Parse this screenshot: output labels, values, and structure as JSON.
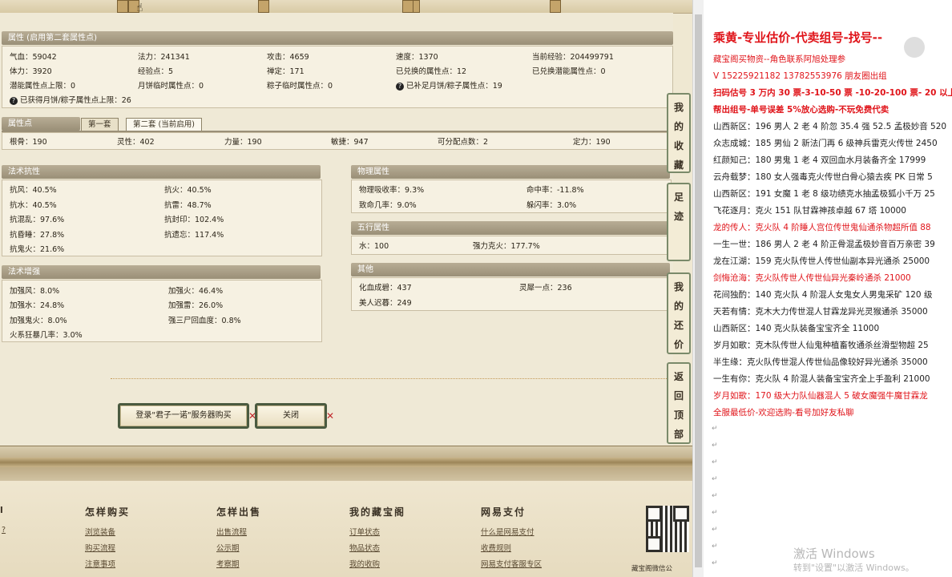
{
  "attrs": {
    "title": "属性 (启用第二套属性点)",
    "r1": [
      "气血：59042",
      "法力：241341",
      "攻击：4659",
      "速度：1370",
      "当前经验：204499791"
    ],
    "r2": [
      "体力：3920",
      "经验点：5",
      "禅定：171",
      "已兑换的属性点：12",
      "已兑换潜能属性点：0"
    ],
    "r3": [
      "潜能属性点上限：0",
      "月饼临时属性点：0",
      "粽子临时属性点：0",
      "已补足月饼/粽子属性点：19"
    ],
    "r4": "已获得月饼/粽子属性点上限：26"
  },
  "points": {
    "title": "属性点",
    "tab1": "第一套",
    "tab2": "第二套 (当前启用)",
    "row": [
      "根骨：190",
      "灵性：402",
      "力量：190",
      "敏捷：947",
      "可分配点数：2",
      "定力：190"
    ]
  },
  "resist": {
    "title": "法术抗性",
    "left": [
      "抗风：40.5%",
      "抗水：40.5%",
      "抗混乱：97.6%",
      "抗昏睡：27.8%",
      "抗鬼火：21.6%"
    ],
    "right": [
      "抗火：40.5%",
      "抗雷：48.7%",
      "抗封印：102.4%",
      "抗遗忘：117.4%"
    ]
  },
  "boost": {
    "title": "法术增强",
    "left": [
      "加强风：8.0%",
      "加强水：24.8%",
      "加强鬼火：8.0%",
      "火系狂暴几率：3.0%"
    ],
    "right": [
      "加强火：46.4%",
      "加强雷：26.0%",
      "强三尸回血度：0.8%"
    ]
  },
  "physical": {
    "title": "物理属性",
    "left": [
      "物理吸收率：9.3%",
      "致命几率：9.0%"
    ],
    "right": [
      "命中率：-11.8%",
      "躲闪率：3.0%"
    ]
  },
  "wuxing": {
    "title": "五行属性",
    "left": "水：100",
    "right": "强力克火：177.7%"
  },
  "other": {
    "title": "其他",
    "left": [
      "化血成碧：437",
      "美人迟暮：249"
    ],
    "right": "灵犀一点：236"
  },
  "buttons": {
    "login": "登录\"君子一诺\"服务器购买",
    "close": "关闭"
  },
  "sidetabs": [
    "我的收藏",
    "足迹",
    "我的还价",
    "返回顶部"
  ],
  "footer": {
    "heads": [
      "怎样购买",
      "怎样出售",
      "我的藏宝阁",
      "网易支付"
    ],
    "col1": [
      "浏览装备",
      "购买流程",
      "注意事项"
    ],
    "col2": [
      "出售流程",
      "公示期",
      "考察期"
    ],
    "col3": [
      "订单状态",
      "物品状态",
      "我的收购"
    ],
    "col4": [
      "什么是网易支付",
      "收费规则",
      "网易支付客服专区"
    ],
    "qr_label": "藏宝阁微信公",
    "left_q": "?"
  },
  "notes": {
    "heading": "乘黄-专业估价-代卖组号-找号--",
    "lines": [
      {
        "t": "藏宝阁买物资--角色联系阿旭处理参",
        "c": "red"
      },
      {
        "t": "V 15225921182    13782553976 朋友圈出组",
        "c": "red"
      },
      {
        "t": "扫码估号 3 万内 30 票-3-10-50 票 -10-20-100 票- 20 以上",
        "c": "redb"
      },
      {
        "t": "帮出组号-单号误差 5%放心选购-不玩免费代卖",
        "c": "redb"
      },
      {
        "t": "山西新区：196 男人 2 老 4 阶忽 35.4 强 52.5 孟极妙音 520",
        "c": "n"
      },
      {
        "t": "众志成城：185 男仙 2 新法门再 6 级神兵雷克火传世 2450",
        "c": "n"
      },
      {
        "t": "红颜知己：180 男鬼 1 老 4 双回血水月装备齐全 17999",
        "c": "n"
      },
      {
        "t": "云舟载梦：180 女人强毒克火传世白骨心猿去疾 PK 日常 5",
        "c": "n"
      },
      {
        "t": "山西新区：191 女魔 1 老 8 级功绩克水抽孟极狐小千万 25",
        "c": "n"
      },
      {
        "t": "飞花逐月：克火 151 队甘霖神孩卓越 67 塔 10000",
        "c": "n"
      },
      {
        "t": "龙的传人：克火队 4 阶睡人宫位传世鬼仙通杀物超所值 88",
        "c": "red"
      },
      {
        "t": "一生一世：186 男人 2 老 4 阶正骨混孟极妙音百万亲密 39",
        "c": "n"
      },
      {
        "t": "龙在江湖：159 克火队传世人传世仙副本异光通杀 25000",
        "c": "n"
      },
      {
        "t": "剑悔沧海：克火队传世人传世仙异光秦岭通杀 21000",
        "c": "red"
      },
      {
        "t": "花间独酌：140 克火队 4 阶混人女鬼女人男鬼采矿 120 级",
        "c": "n"
      },
      {
        "t": "天若有情：克木大力传世混人甘霖龙异光灵猴通杀 35000",
        "c": "n"
      },
      {
        "t": "山西新区：140 克火队装备宝宝齐全 11000",
        "c": "n"
      },
      {
        "t": "岁月如歌：克木队传世人仙鬼种植畜牧通杀丝滑型物超 25",
        "c": "n"
      },
      {
        "t": "半生缘：克火队传世混人传世仙品像较好异光通杀 35000",
        "c": "n"
      },
      {
        "t": "一生有你：克火队 4 阶混人装备宝宝齐全上手盈利 21000",
        "c": "n"
      },
      {
        "t": "岁月如歌：170 级大力队仙器混人 5 破女魔强牛魔甘霖龙",
        "c": "red"
      },
      {
        "t": "全服最低价-欢迎选购-看号加好友私聊",
        "c": "red"
      }
    ],
    "return_mark": "↵"
  },
  "watermark": {
    "line1": "激活 Windows",
    "line2": "转到\"设置\"以激活 Windows。"
  }
}
